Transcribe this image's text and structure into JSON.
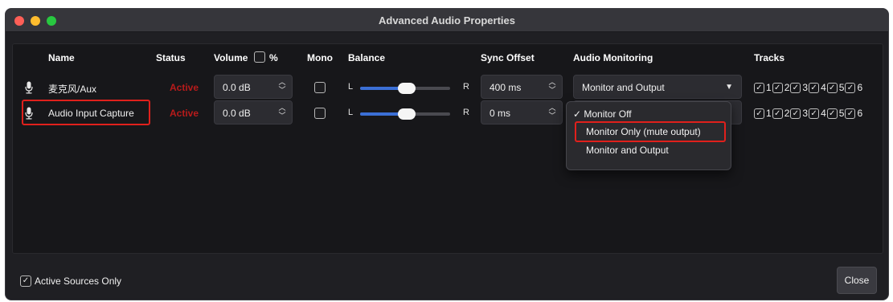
{
  "window": {
    "title": "Advanced Audio Properties"
  },
  "headers": {
    "name": "Name",
    "status": "Status",
    "volume": "Volume",
    "percent": "%",
    "mono": "Mono",
    "balance": "Balance",
    "sync_offset": "Sync Offset",
    "audio_monitoring": "Audio Monitoring",
    "tracks": "Tracks"
  },
  "rows": [
    {
      "name": "麦克风/Aux",
      "status": "Active",
      "volume": "0.0 dB",
      "mono": false,
      "balance_left": "L",
      "balance_right": "R",
      "balance_position": 0.5,
      "sync_offset": "400 ms",
      "monitoring": "Monitor and Output",
      "tracks": [
        "1",
        "2",
        "3",
        "4",
        "5",
        "6"
      ]
    },
    {
      "name": "Audio Input Capture",
      "status": "Active",
      "volume": "0.0 dB",
      "mono": false,
      "balance_left": "L",
      "balance_right": "R",
      "balance_position": 0.5,
      "sync_offset": "0 ms",
      "monitoring": "Monitor Off",
      "tracks": [
        "1",
        "2",
        "3",
        "4",
        "5",
        "6"
      ]
    }
  ],
  "monitoring_dropdown": {
    "options": [
      "Monitor Off",
      "Monitor Only (mute output)",
      "Monitor and Output"
    ],
    "selected": "Monitor Off",
    "highlighted": "Monitor Only (mute output)"
  },
  "footer": {
    "active_sources_only": "Active Sources Only",
    "close": "Close"
  },
  "colors": {
    "status_active": "#b81b1b",
    "highlight": "#e0201c",
    "slider_fill": "#3b6fd6"
  },
  "icons": {
    "source_icon": "microphone-icon",
    "spin_icon": "spin-arrows-icon",
    "caret_icon": "chevron-down-icon",
    "check_icon": "checkmark-icon"
  }
}
